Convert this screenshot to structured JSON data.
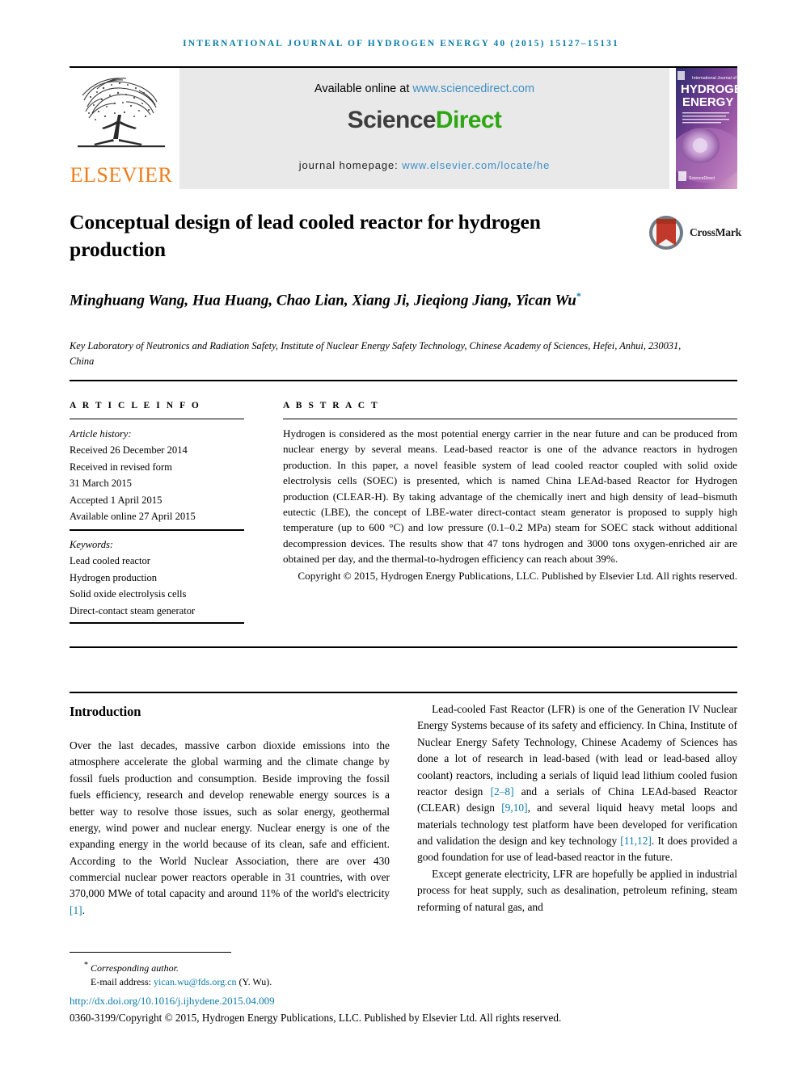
{
  "running_head": "International Journal of Hydrogen Energy 40 (2015) 15127–15131",
  "masthead": {
    "publisher": "ELSEVIER",
    "available_text": "Available online at",
    "available_url": "www.sciencedirect.com",
    "brand_first": "Science",
    "brand_second": "Direct",
    "homepage_label": "journal homepage:",
    "homepage_url": "www.elsevier.com/locate/he",
    "cover": {
      "line1": "International Journal of",
      "line2": "HYDROGEN",
      "line3": "ENERGY",
      "editors": "Editors-in-Chief: T. Nejat Veziroglu, Associate Editors: A. Rosen, D.Y. Goswami, A.A. Evers, A.E. Abrashi, J.W. Sheffield, Lu Erd and T.A. Semelsberger",
      "footer": "ScienceDirect"
    },
    "colors": {
      "elsevier_orange": "#ef7d1a",
      "link_blue": "#3f8fc4",
      "sciencedirect_green": "#2fa614",
      "panel_gray": "#e9e9e9"
    }
  },
  "article": {
    "title": "Conceptual design of lead cooled reactor for hydrogen production",
    "crossmark_label": "CrossMark",
    "authors": "Minghuang Wang, Hua Huang, Chao Lian, Xiang Ji, Jieqiong Jiang, Yican Wu",
    "author_marker": "*",
    "affiliation": "Key Laboratory of Neutronics and Radiation Safety, Institute of Nuclear Energy Safety Technology, Chinese Academy of Sciences, Hefei, Anhui, 230031, China"
  },
  "info": {
    "heading": "A R T I C L E   I N F O",
    "history_label": "Article history:",
    "history": [
      "Received 26 December 2014",
      "Received in revised form",
      "31 March 2015",
      "Accepted 1 April 2015",
      "Available online 27 April 2015"
    ],
    "keywords_label": "Keywords:",
    "keywords": [
      "Lead cooled reactor",
      "Hydrogen production",
      "Solid oxide electrolysis cells",
      "Direct-contact steam generator"
    ]
  },
  "abstract": {
    "heading": "A B S T R A C T",
    "text": "Hydrogen is considered as the most potential energy carrier in the near future and can be produced from nuclear energy by several means. Lead-based reactor is one of the advance reactors in hydrogen production. In this paper, a novel feasible system of lead cooled reactor coupled with solid oxide electrolysis cells (SOEC) is presented, which is named China LEAd-based Reactor for Hydrogen production (CLEAR-H). By taking advantage of the chemically inert and high density of lead–bismuth eutectic (LBE), the concept of LBE-water direct-contact steam generator is proposed to supply high temperature (up to 600 °C) and low pressure (0.1–0.2 MPa) steam for SOEC stack without additional decompression devices. The results show that 47 tons hydrogen and 3000 tons oxygen-enriched air are obtained per day, and the thermal-to-hydrogen efficiency can reach about 39%.",
    "copyright": "Copyright © 2015, Hydrogen Energy Publications, LLC. Published by Elsevier Ltd. All rights reserved."
  },
  "body": {
    "section_title": "Introduction",
    "left_paragraph": "Over the last decades, massive carbon dioxide emissions into the atmosphere accelerate the global warming and the climate change by fossil fuels production and consumption. Beside improving the fossil fuels efficiency, research and develop renewable energy sources is a better way to resolve those issues, such as solar energy, geothermal energy, wind power and nuclear energy. Nuclear energy is one of the expanding energy in the world because of its clean, safe and efficient. According to the World Nuclear Association, there are over 430 commercial nuclear power reactors operable in 31 countries, with over 370,000 MWe of total capacity and around 11% of the world's electricity ",
    "left_ref": "[1]",
    "right_p1_a": "Lead-cooled Fast Reactor (LFR) is one of the Generation IV Nuclear Energy Systems because of its safety and efficiency. In China, Institute of Nuclear Energy Safety Technology, Chinese Academy of Sciences has done a lot of research in lead-based (with lead or lead-based alloy coolant) reactors, including a serials of liquid lead lithium cooled fusion reactor design ",
    "right_ref1": "[2–8]",
    "right_p1_b": " and a serials of China LEAd-based Reactor (CLEAR) design ",
    "right_ref2": "[9,10]",
    "right_p1_c": ", and several liquid heavy metal loops and materials technology test platform have been developed for verification and validation the design and key technology ",
    "right_ref3": "[11,12]",
    "right_p1_d": ". It does provided a good foundation for use of lead-based reactor in the future.",
    "right_p2": "Except generate electricity, LFR are hopefully be applied in industrial process for heat supply, such as desalination, petroleum refining, steam reforming of natural gas, and"
  },
  "footer": {
    "corresponding_marker": "*",
    "corresponding_label": "Corresponding author.",
    "email_label": "E-mail address:",
    "email": "yican.wu@fds.org.cn",
    "email_suffix": "(Y. Wu).",
    "doi": "http://dx.doi.org/10.1016/j.ijhydene.2015.04.009",
    "issn_line": "0360-3199/Copyright © 2015, Hydrogen Energy Publications, LLC. Published by Elsevier Ltd. All rights reserved."
  }
}
